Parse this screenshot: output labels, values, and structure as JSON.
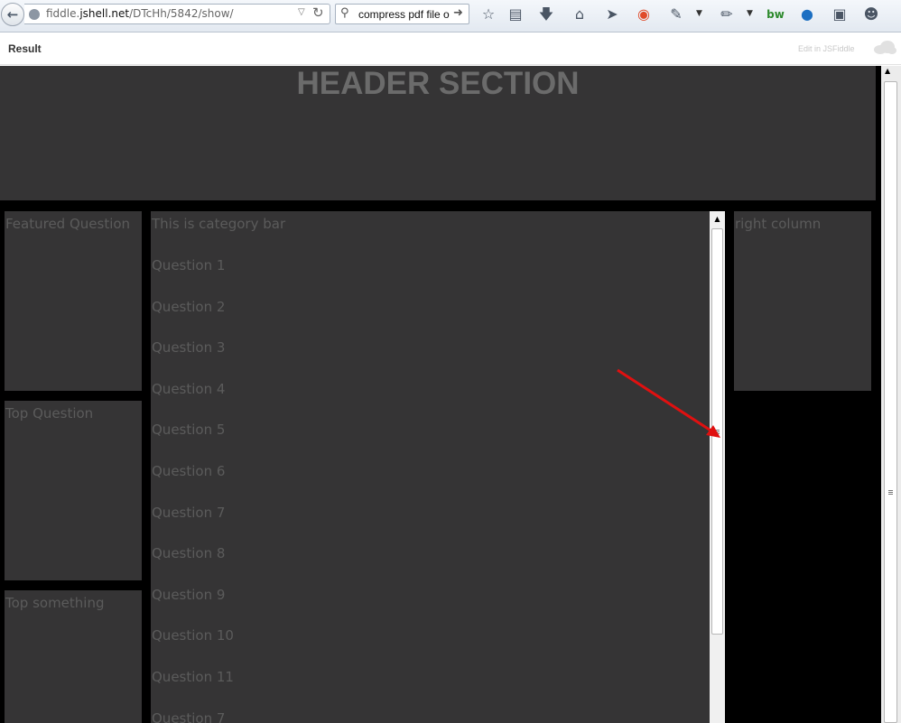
{
  "browser": {
    "url_prefix": "fiddle.",
    "url_domain": "jshell.net",
    "url_path": "/DTcHh/5842/show/",
    "search_value": "compress pdf file o"
  },
  "fiddle": {
    "result_label": "Result",
    "edit_link": "Edit in JSFiddle"
  },
  "page": {
    "header_title": "HEADER SECTION",
    "left_panels": [
      "Featured Question",
      "Top Question",
      "Top something"
    ],
    "category_bar": "This is category bar",
    "questions": [
      "Question 1",
      "Question 2",
      "Question 3",
      "Question 4",
      "Question 5",
      "Question 6",
      "Question 7",
      "Question 8",
      "Question 9",
      "Question 10",
      "Question 11",
      "Question 7"
    ],
    "right_column": "right column"
  },
  "colors": {
    "panel_bg": "#353435",
    "page_bg": "#000000",
    "panel_text": "#5b5b5b",
    "annotation_arrow": "#e01010"
  }
}
